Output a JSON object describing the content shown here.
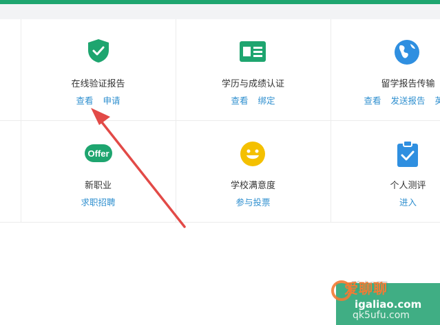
{
  "colors": {
    "brand": "#1ea56f",
    "link": "#2f8fcf",
    "shield": "#1ea56f",
    "card": "#1ea56f",
    "globe": "#2f8fe0",
    "offer": "#1ea56f",
    "smiley": "#f4c000",
    "clipboard": "#2f8fe0",
    "arrow": "#e24a47"
  },
  "services": [
    {
      "title": "在线验证报告",
      "icon": "shield-check-icon",
      "links": [
        "查看",
        "申请"
      ]
    },
    {
      "title": "学历与成绩认证",
      "icon": "id-card-icon",
      "links": [
        "查看",
        "绑定"
      ]
    },
    {
      "title": "留学报告传输",
      "icon": "globe-icon",
      "links": [
        "查看",
        "发送报告",
        "英文"
      ]
    },
    {
      "title": "新职业",
      "icon": "offer-badge-icon",
      "badge": "Offer",
      "links": [
        "求职招聘"
      ]
    },
    {
      "title": "学校满意度",
      "icon": "smiley-icon",
      "links": [
        "参与投票"
      ]
    },
    {
      "title": "个人测评",
      "icon": "clipboard-check-icon",
      "links": [
        "进入"
      ]
    }
  ],
  "watermark": {
    "text": "爱聊聊",
    "url": "igaliao.com",
    "url2": "qk5ufu.com",
    "faint": "聊知网"
  }
}
